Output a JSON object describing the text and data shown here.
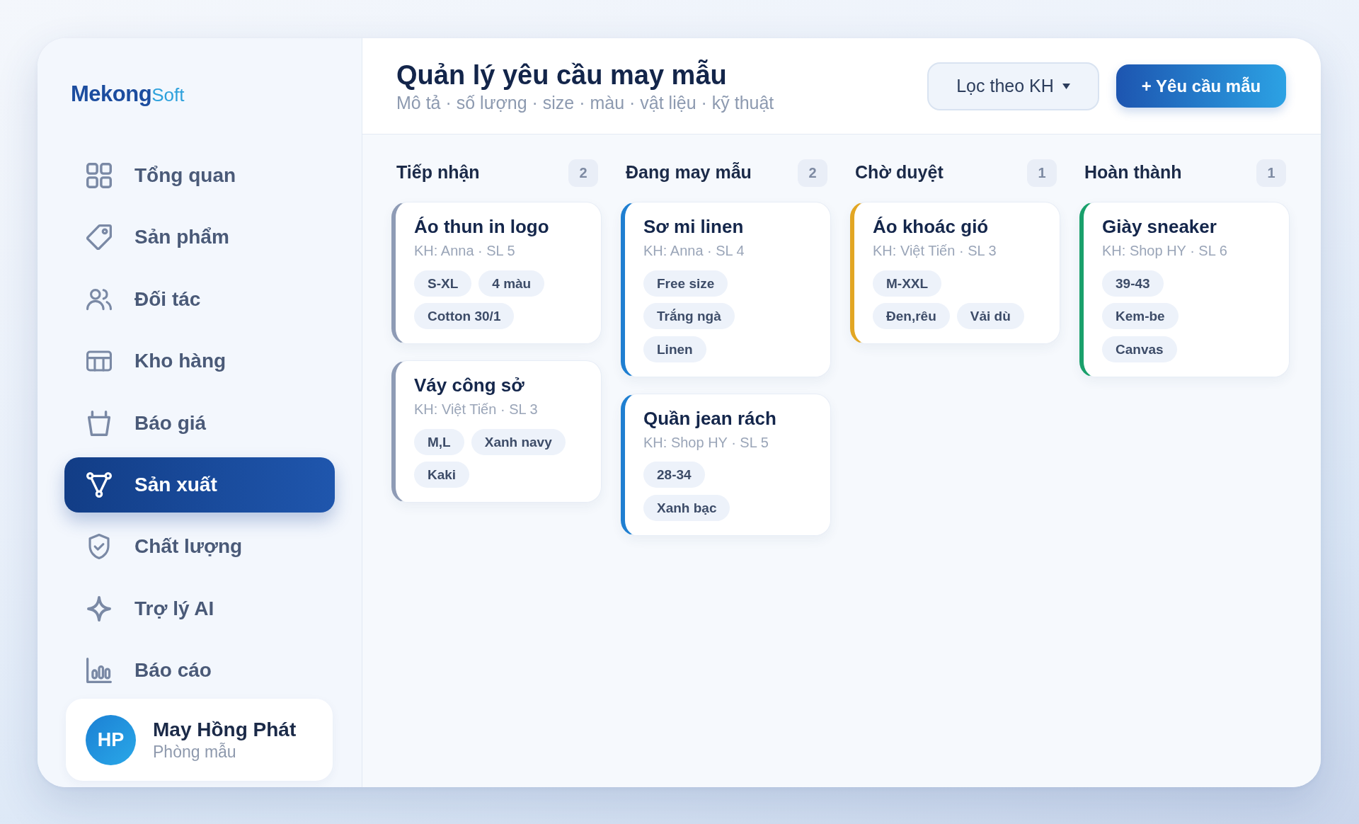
{
  "sidebar": {
    "logo": {
      "primary": "Mekong",
      "secondary": "Soft"
    },
    "items": [
      {
        "label": "Tổng quan",
        "selected": false
      },
      {
        "label": "Sản phẩm",
        "selected": false
      },
      {
        "label": "Đối tác",
        "selected": false
      },
      {
        "label": "Kho hàng",
        "selected": false
      },
      {
        "label": "Báo giá",
        "selected": false
      },
      {
        "label": "Sản xuất",
        "selected": true
      },
      {
        "label": "Chất lượng",
        "selected": false
      },
      {
        "label": "Trợ lý AI",
        "selected": false
      },
      {
        "label": "Báo cáo",
        "selected": false
      }
    ],
    "user": {
      "initials": "HP",
      "name": "May Hồng Phát",
      "role": "Phòng mẫu"
    }
  },
  "header": {
    "title": "Quản lý yêu cầu may mẫu",
    "subtitle": "Mô tả · số lượng · size · màu · vật liệu · kỹ thuật",
    "filter_button": "Lọc theo KH",
    "primary_button": "+ Yêu cầu mẫu"
  },
  "columns": [
    {
      "title": "Tiếp nhận",
      "count": "2",
      "color": "#8e9bb5",
      "cards": [
        {
          "title": "Áo thun in logo",
          "meta": "KH: Anna · SL 5",
          "tag_rows": [
            [
              "S-XL",
              "4 màu"
            ],
            [
              "Cotton 30/1"
            ]
          ]
        },
        {
          "title": "Váy công sở",
          "meta": "KH: Việt Tiến · SL 3",
          "tag_rows": [
            [
              "M,L",
              "Xanh navy"
            ],
            [
              "Kaki"
            ]
          ]
        }
      ]
    },
    {
      "title": "Đang may mẫu",
      "count": "2",
      "color": "#1f7fd1",
      "cards": [
        {
          "title": "Sơ mi linen",
          "meta": "KH: Anna · SL 4",
          "tag_rows": [
            [
              "Free size"
            ],
            [
              "Trắng ngà"
            ],
            [
              "Linen"
            ]
          ]
        },
        {
          "title": "Quần jean rách",
          "meta": "KH: Shop HY · SL 5",
          "tag_rows": [
            [
              "28-34"
            ],
            [
              "Xanh bạc"
            ]
          ]
        }
      ]
    },
    {
      "title": "Chờ duyệt",
      "count": "1",
      "color": "#e2a623",
      "cards": [
        {
          "title": "Áo khoác gió",
          "meta": "KH: Việt Tiến · SL 3",
          "tag_rows": [
            [
              "M-XXL"
            ],
            [
              "Đen,rêu",
              "Vải dù"
            ]
          ]
        }
      ]
    },
    {
      "title": "Hoàn thành",
      "count": "1",
      "color": "#19a06b",
      "cards": [
        {
          "title": "Giày sneaker",
          "meta": "KH: Shop HY · SL 6",
          "tag_rows": [
            [
              "39-43"
            ],
            [
              "Kem-be"
            ],
            [
              "Canvas"
            ]
          ]
        }
      ]
    }
  ]
}
